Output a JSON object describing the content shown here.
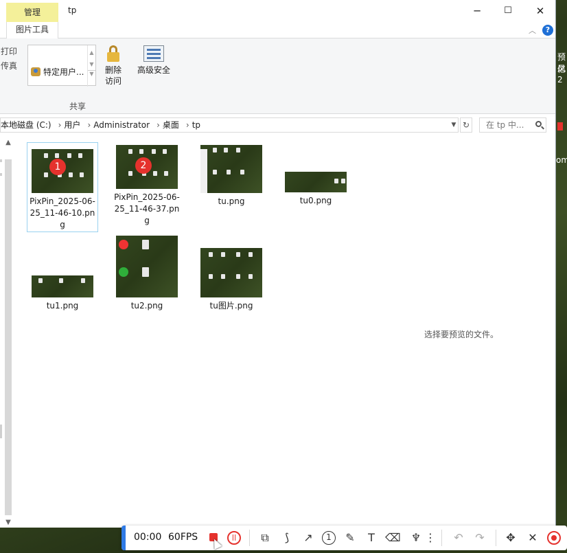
{
  "titlebar": {
    "context_tab": "管理",
    "context_sub": "图片工具",
    "title": "tp",
    "minimize": "─",
    "maximize": "☐",
    "close": "✕"
  },
  "ribbon": {
    "print_label": "打印",
    "fax_label": "传真",
    "share_list_item": "特定用户...",
    "remove_access_line1": "删除",
    "remove_access_line2": "访问",
    "advanced_security": "高级安全",
    "group_label": "共享",
    "help": "?"
  },
  "address": {
    "crumbs": [
      "本地磁盘 (C:)",
      "用户",
      "Administrator",
      "桌面",
      "tp"
    ],
    "search_placeholder": "在 tp 中..."
  },
  "files": [
    {
      "name": "PixPin_2025-06-25_11-46-10.png",
      "badge": "1"
    },
    {
      "name": "PixPin_2025-06-25_11-46-37.png",
      "badge": "2"
    },
    {
      "name": "tu.png"
    },
    {
      "name": "tu0.png"
    },
    {
      "name": "tu1.png"
    },
    {
      "name": "tu2.png"
    },
    {
      "name": "tu图片.png"
    }
  ],
  "preview_note": "选择要预览的文件。",
  "desktop": {
    "text1": "预风",
    "text2": "亿2",
    "text3": "om"
  },
  "recorder": {
    "time": "00:00",
    "fps": "60FPS",
    "number_tool": "1",
    "tools": [
      "shape-tool",
      "polyline-tool",
      "arrow-tool",
      "number-tool",
      "pen-tool",
      "text-tool",
      "eraser-tool",
      "highlight-tool",
      "more-tool",
      "undo",
      "redo",
      "move",
      "close",
      "record"
    ]
  },
  "colors": {
    "context_tab_bg": "#f4f09a",
    "accent_blue": "#2f7ae5",
    "record_red": "#e5322d",
    "selection_border": "#99d1ef"
  }
}
